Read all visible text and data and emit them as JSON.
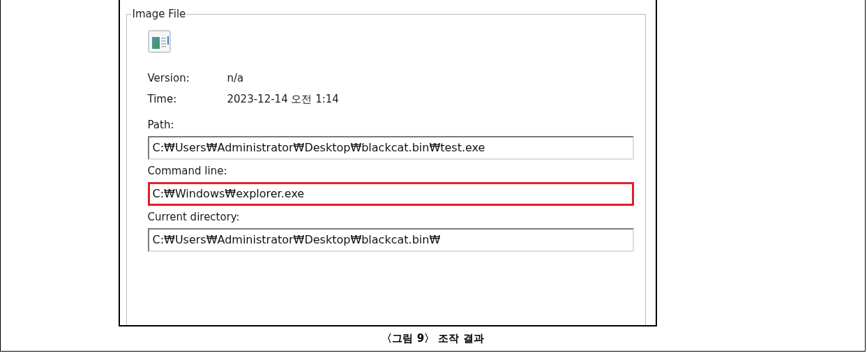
{
  "group_box": {
    "title": "Image File",
    "info_rows": [
      {
        "label": "Version:",
        "value": "n/a"
      },
      {
        "label": "Time:",
        "value": "2023-12-14 오전 1:14"
      }
    ],
    "fields": [
      {
        "label": "Path:",
        "value": "C:₩Users₩Administrator₩Desktop₩blackcat.bin₩test.exe",
        "highlighted": false
      },
      {
        "label": "Command line:",
        "value": "C:₩Windows₩explorer.exe",
        "highlighted": true
      },
      {
        "label": "Current directory:",
        "value": "C:₩Users₩Administrator₩Desktop₩blackcat.bin₩",
        "highlighted": false
      }
    ]
  },
  "caption": "〈그림 9〉 조작 결과"
}
